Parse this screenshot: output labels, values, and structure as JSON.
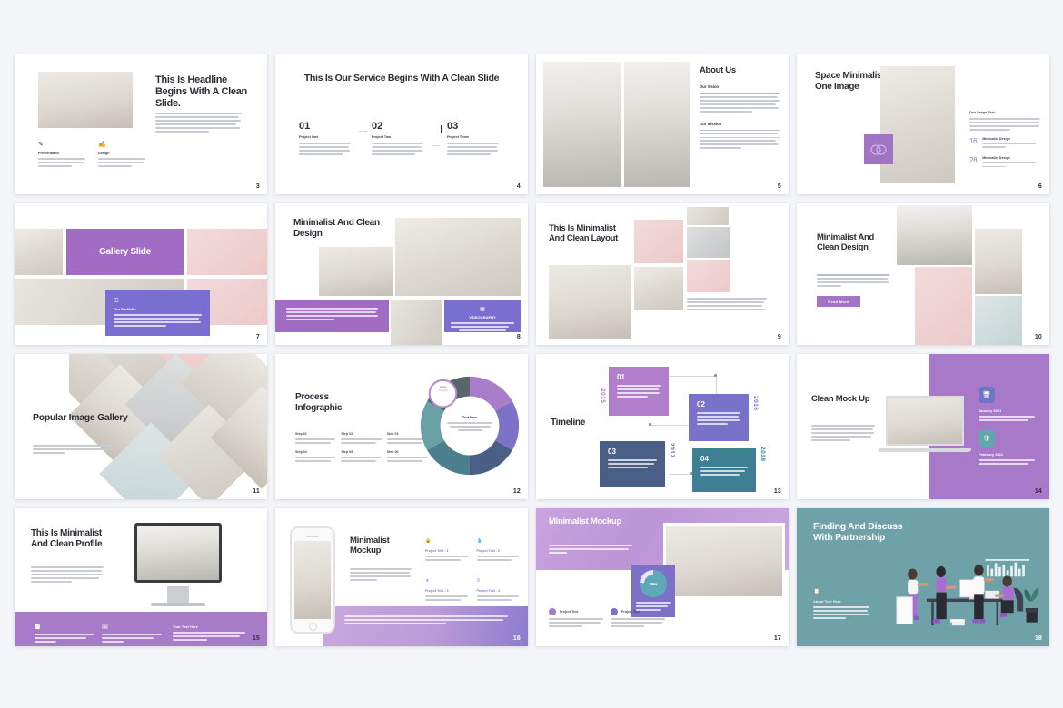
{
  "page": {
    "background": "#f4f5f8",
    "accent_purple": "#a06cc4",
    "accent_blue_purple": "#7a6fd0",
    "accent_teal": "#6fa2a8",
    "text_dark": "#2b2d33"
  },
  "slides": [
    {
      "number": "3",
      "name": "headline-clean-slide",
      "title": "This Is Headline Begins With A Clean Slide.",
      "paragraph": "A wonderful serenity has taken possession of my entire soul, like these sweet mornings of spring which I enjoy with my whole heart. I am alone, and feel the charm of existence in this spot, which was created for the bliss of souls like mine. I am so happy.",
      "features": [
        {
          "icon": "pen-icon",
          "label": "Presentation",
          "text": "A wonderful serenity has taken possession of my entire soul, like these sweet mornings."
        },
        {
          "icon": "brush-icon",
          "label": "Design",
          "text": "A wonderful serenity has taken possession of my entire soul, like these sweet mornings."
        }
      ]
    },
    {
      "number": "4",
      "name": "service-begins-clean-slide",
      "title": "This Is Our Service Begins With A Clean Slide",
      "columns": [
        {
          "num": "01",
          "label": "Project One",
          "text": "A wonderful serenity has taken possession of my entire soul, like these sweet mornings of spring which I enjoy with my whole heart. I am alone."
        },
        {
          "num": "02",
          "label": "Project Two",
          "text": "A wonderful serenity has taken possession of my entire soul, like these sweet mornings of spring which I enjoy with my whole heart. I am alone."
        },
        {
          "num": "03",
          "label": "Project Three",
          "text": "A wonderful serenity has taken possession of my entire soul, like these sweet mornings of spring which I enjoy with my whole heart. I am alone."
        }
      ]
    },
    {
      "number": "5",
      "name": "about-us",
      "title": "About Us",
      "sections": [
        {
          "heading": "Our Vision",
          "lead": "A wonderful serenity",
          "text": "has taken possession of my entire soul, like these sweet mornings of spring which I enjoy with my whole heart. I am alone, and feel the charm of existence in this spot, which was created for the bliss of souls like mine. I am so happy."
        },
        {
          "heading": "Our Mission",
          "lead": "A Wonderful Serenity",
          "text": "Has Taken Possession Of My Entire Soul, Like These Sweet Mornings Of Spring Which I Enjoy With My Whole Heart. I Am Alone, And Feel The Charm Of Existence In This Spot, Which Was Created For The Bliss Of Souls Like Mine. I Am So Happy."
        }
      ]
    },
    {
      "number": "6",
      "name": "space-minimalist-one-image",
      "title": "Space Minimalist One Image",
      "side_heading": "One Image Text",
      "side_text": "A wonderful serenity has taken possession of my entire soul, like these sweet mornings of spring which I enjoy with my whole heart.",
      "stats": [
        {
          "value": "16",
          "label": "Minimalist Design",
          "text": "A wonderful serenity has taken."
        },
        {
          "value": "28",
          "label": "Minimalist Design",
          "text": "A wonderful serenity has taken."
        }
      ]
    },
    {
      "number": "7",
      "name": "gallery-slide",
      "banner": "Gallery Slide",
      "card": {
        "icon": "gallery-icon",
        "title": "Our Portfolio",
        "text": "A wonderful serenity has taken possession of my entire soul, like these sweet mornings of spring which I enjoy with my whole heart. I am alone, and feel the charm of existence in this spot, which was created for the bliss of souls like mine. I am so happy."
      }
    },
    {
      "number": "8",
      "name": "minimalist-clean-design-a",
      "title": "Minimalist And Clean Design",
      "purple_text": "A wonderful serenity has taken possession of my entire soul, like these sweet mornings of spring which I enjoy with my whole heart. I am alone, and feel the charm of existence in this spot.",
      "badge": {
        "icon": "camera-icon",
        "title": "VIDEOGRAPHY",
        "text": "A wonderful serenity has taken possession of my entire soul, like these sweet mornings."
      }
    },
    {
      "number": "9",
      "name": "minimalist-clean-layout",
      "title": "This Is Minimalist And Clean Layout",
      "text": "A wonderful serenity has taken possession of my entire soul, like these sweet mornings of spring which I enjoy with my whole heart. I am alone, and feel the charm of existence in this spot, which was created for the bliss."
    },
    {
      "number": "10",
      "name": "minimalist-clean-design-b",
      "title": "Minimalist And Clean Design",
      "lead": "A wonderful serenity",
      "text": "has taken possession of my entire soul, like these sweet mornings of spring which I enjoy with my whole heart. I am alone, and feel the charm of existence.",
      "button": "Read More"
    },
    {
      "number": "11",
      "name": "popular-image-gallery",
      "title": "Popular Image Gallery",
      "text": "A wonderful serenity has taken possession of my entire soul, like these sweet mornings of spring which I enjoy with my whole heart. I am alone."
    },
    {
      "number": "12",
      "name": "process-infographic",
      "title": "Process Infographic",
      "center": {
        "title": "Text Here",
        "text": "A wonderful serenity has taken possession of my entire."
      },
      "badge": {
        "value": "50%",
        "label": "Complete"
      },
      "steps": [
        {
          "label": "Step 01",
          "text": "A wonderful serenity has taken possession."
        },
        {
          "label": "Step 02",
          "text": "A wonderful serenity has taken possession."
        },
        {
          "label": "Step 03",
          "text": "A wonderful serenity has taken possession."
        },
        {
          "label": "Step 04",
          "text": "A wonderful serenity has taken possession."
        },
        {
          "label": "Step 05",
          "text": "A wonderful serenity has taken possession."
        },
        {
          "label": "Step 06",
          "text": "A wonderful serenity has taken possession."
        }
      ]
    },
    {
      "number": "13",
      "name": "timeline",
      "title": "Timeline",
      "items": [
        {
          "num": "01",
          "year": "2015",
          "color": "#b07ecb",
          "text": "A wonderful serenity has taken possession of my entire soul, like these sweet mornings of spring which I enjoy with my whole heart."
        },
        {
          "num": "02",
          "year": "2016",
          "color": "#7a71c9",
          "text": "A wonderful serenity has taken possession of my entire soul, like these sweet mornings of spring which I enjoy with my whole heart."
        },
        {
          "num": "03",
          "year": "2017",
          "color": "#4a5f86",
          "text": "A wonderful serenity has taken possession of my entire soul, like these sweet mornings of spring which I enjoy with my whole heart."
        },
        {
          "num": "04",
          "year": "2018",
          "color": "#3f7f93",
          "text": "A wonderful serenity has taken possession of my entire soul, like these sweet mornings of spring which I enjoy with my whole heart."
        }
      ]
    },
    {
      "number": "14",
      "name": "clean-mock-up",
      "title": "Clean Mock Up",
      "text": "A wonderful serenity has taken possession of my entire soul, like these sweet mornings of spring which I enjoy with my whole heart. I am alone, and feel the charm of existence in this spot, which was created for the bliss.",
      "months": [
        {
          "icon": "monitor-icon",
          "color": "#6e76c4",
          "title": "January 2021",
          "text": "A wonderful serenity has taken possession of my entire soul."
        },
        {
          "icon": "shield-icon",
          "color": "#5fa8b0",
          "title": "February 2021",
          "text": "A wonderful serenity has taken possession of my entire soul."
        }
      ]
    },
    {
      "number": "15",
      "name": "minimalist-clean-profile",
      "title": "This Is Minimalist And Clean Profile",
      "text": "A wonderful serenity has taken possession of my entire soul, like these sweet mornings of spring which I enjoy with my whole heart. I am alone, and feel the charm of existence in this spot, which was created for the bliss of souls like mine. I am so happy.",
      "cards": [
        {
          "icon": "document-icon",
          "label": "Consectetuer Adipiscing Elit, Sed",
          "text": "Diam Nonummy Nibh Euismod Tincidunt Ut Laoreet."
        },
        {
          "icon": "image-icon",
          "label": "Lorem Ipsum Dolor Sit Amet",
          "text": "Consectetuer Adipiscing Elit, Sed Diam Nonummy Nibh."
        },
        {
          "icon": "",
          "label": "Your Text Here",
          "lead": "A wonderful",
          "text": "serenity has taken possession of my entire soul, like these sweet mornings of spring."
        }
      ]
    },
    {
      "number": "16",
      "name": "minimalist-mockup-phone",
      "title": "Minimalist Mockup",
      "text": "A wonderful serenity has taken possession of my entire soul, like these sweet mornings of spring which I enjoy with my whole heart.",
      "points": [
        {
          "icon": "lock-icon",
          "label": "Project Text - 1",
          "text": "A wonderful serenity has taken possession."
        },
        {
          "icon": "drop-icon",
          "label": "Project Text - 2",
          "text": "A wonderful serenity has taken possession."
        },
        {
          "icon": "star-icon",
          "label": "Project Text - 3",
          "text": "A wonderful serenity has taken possession."
        },
        {
          "icon": "clock-icon",
          "label": "Project Text - 4",
          "text": "A wonderful serenity has taken possession."
        }
      ],
      "footer_text": "A wonderful serenity has taken possession of my entire soul, like these sweet mornings of spring which I enjoy with my whole heart. I am alone, and feel the charm of existence."
    },
    {
      "number": "17",
      "name": "minimalist-mockup-purple",
      "title": "Minimalist Mockup",
      "text": "A wonderful serenity has taken possession of my entire soul, like these sweet mornings of spring which I enjoy with my whole heart.",
      "projects": [
        {
          "label": "Project Text",
          "color": "#a87bc9",
          "text": "A wonderful serenity has taken possession of my entire soul."
        },
        {
          "label": "Project Text",
          "color": "#7d70c9",
          "text": "A wonderful serenity has taken possession of my entire soul."
        }
      ],
      "card": {
        "value": "76%",
        "text": "A wonderful serenity has taken possession of my entire soul."
      }
    },
    {
      "number": "18",
      "name": "finding-discuss-partnership",
      "title": "Finding And Discuss With Partnership",
      "icon": "document-icon",
      "subtitle": "About Text Here",
      "text": "A wonderful serenity has taken possession of my entire soul, like these sweet mornings of spring which I enjoy."
    }
  ]
}
